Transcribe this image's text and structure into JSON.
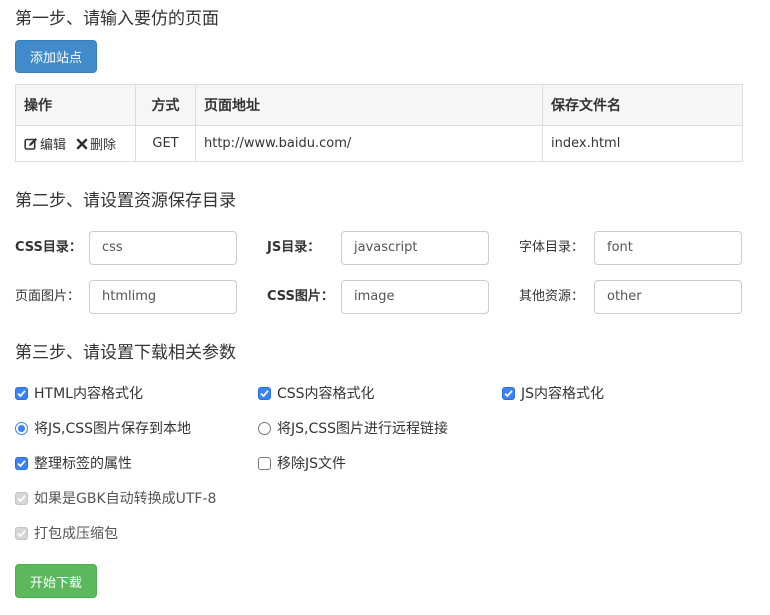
{
  "step1": {
    "title": "第一步、请输入要仿的页面",
    "add_site_label": "添加站点",
    "table": {
      "headers": [
        "操作",
        "方式",
        "页面地址",
        "保存文件名"
      ],
      "rows": [
        {
          "edit_label": "编辑",
          "delete_label": "删除",
          "method": "GET",
          "url": "http://www.baidu.com/",
          "filename": "index.html"
        }
      ]
    }
  },
  "step2": {
    "title": "第二步、请设置资源保存目录",
    "fields": {
      "css_dir": {
        "label": "CSS目录：",
        "value": "css"
      },
      "js_dir": {
        "label": "JS目录：",
        "value": "javascript"
      },
      "font_dir": {
        "label": "字体目录：",
        "value": "font"
      },
      "page_img": {
        "label": "页面图片：",
        "value": "htmlimg"
      },
      "css_img": {
        "label": "CSS图片：",
        "value": "image"
      },
      "other": {
        "label": "其他资源：",
        "value": "other"
      }
    }
  },
  "step3": {
    "title": "第三步、请设置下载相关参数",
    "options": {
      "html_format": {
        "label": "HTML内容格式化",
        "checked": true
      },
      "css_format": {
        "label": "CSS内容格式化",
        "checked": true
      },
      "js_format": {
        "label": "JS内容格式化",
        "checked": true
      },
      "save_local": {
        "label": "将JS,CSS图片保存到本地",
        "selected": true
      },
      "remote_link": {
        "label": "将JS,CSS图片进行远程链接",
        "selected": false
      },
      "tidy_attrs": {
        "label": "整理标签的属性",
        "checked": true
      },
      "remove_js": {
        "label": "移除JS文件",
        "checked": false
      },
      "gbk_convert": {
        "label": "如果是GBK自动转换成UTF-8",
        "checked": true,
        "disabled": true
      },
      "zip": {
        "label": "打包成压缩包",
        "checked": true,
        "disabled": true
      }
    },
    "start_label": "开始下载"
  },
  "colors": {
    "primary": "#428bca",
    "success": "#5cb85c",
    "checkbox": "#3b82f6",
    "border": "#dddddd"
  }
}
